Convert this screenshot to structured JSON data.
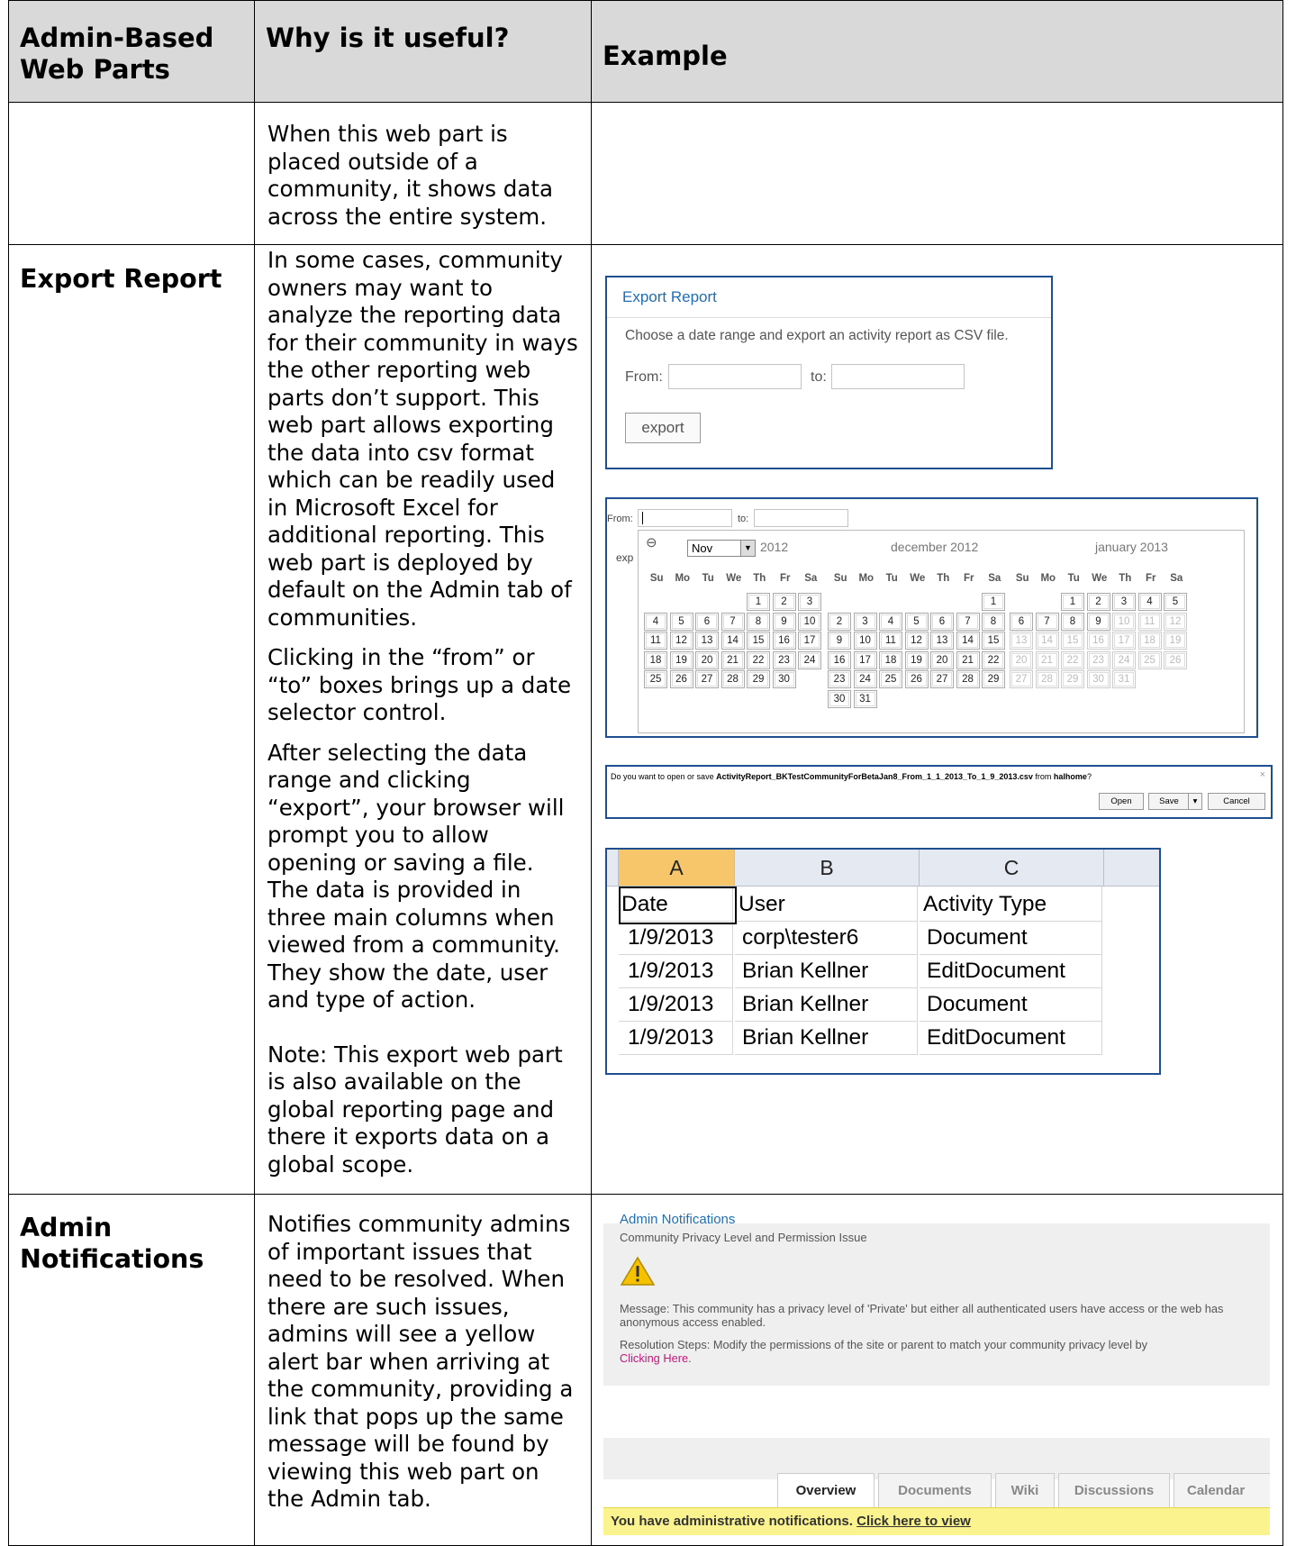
{
  "table": {
    "headers": [
      "Admin-Based Web Parts",
      "Why is it useful?",
      "Example"
    ],
    "row0": {
      "desc": "When this web part is placed outside of a community, it shows data across the entire system."
    },
    "row1": {
      "label": "Export Report",
      "p1": "In some cases, community owners may want to analyze the reporting data for their community in ways the other reporting web parts don’t support.  This web part allows exporting the data into csv format which can be readily used in Microsoft Excel for additional reporting.  This web part is deployed by default on the Admin tab of communities.",
      "p2": "Clicking in the “from” or “to” boxes brings up a date selector control.",
      "p3a": "After selecting the data range and clicking “export”, your browser will prompt you to allow opening or saving a file.",
      "p3b": "The data is provided in three main columns when viewed from a community.  They show the date, user and type of action.",
      "p4": "Note:  This export web part is also available on the global reporting page and there it exports data on a global scope."
    },
    "row2": {
      "label": "Admin Notifications",
      "desc": "Notifies community admins of important issues that need to be resolved.  When there are such issues, admins will see a yellow alert bar when arriving at the community, providing a link that pops up the same message will be found by viewing this web part on the Admin tab."
    }
  },
  "export_panel": {
    "title": "Export Report",
    "desc": "Choose a date range and export an activity report as CSV file.",
    "from_label": "From:",
    "to_label": "to:",
    "button": "export"
  },
  "calendar": {
    "from_label": "From:",
    "to_label": "to:",
    "side_text": "exp",
    "prev_icon": "⊖",
    "month_select": "Nov",
    "year": "2012",
    "month_titles": [
      "december 2012",
      "january 2013"
    ],
    "dow": [
      "Su",
      "Mo",
      "Tu",
      "We",
      "Th",
      "Fr",
      "Sa"
    ]
  },
  "download_prompt": {
    "q1": "Do you want to open or save ",
    "file": "ActivityReport_BKTestCommunityForBetaJan8_From_1_1_2013_To_1_9_2013.csv",
    "q2": " from ",
    "host": "halhome",
    "q3": "?",
    "close": "×",
    "open": "Open",
    "save": "Save",
    "cancel": "Cancel"
  },
  "excel": {
    "columns": [
      "A",
      "B",
      "C"
    ],
    "header": [
      "Date",
      "User",
      "Activity Type"
    ],
    "rows": [
      [
        "1/9/2013",
        "corp\\tester6",
        "Document"
      ],
      [
        "1/9/2013",
        "Brian Kellner",
        "EditDocument"
      ],
      [
        "1/9/2013",
        "Brian Kellner",
        "Document"
      ],
      [
        "1/9/2013",
        "Brian Kellner",
        "EditDocument"
      ]
    ]
  },
  "admin_notifications": {
    "title": "Admin Notifications",
    "issue": "Community Privacy Level and Permission Issue",
    "message": "Message: This community has a privacy level of 'Private' but either all authenticated users have access or the web has anonymous access enabled.",
    "resolution": "Resolution Steps: Modify the permissions of the site or parent to match your community privacy level by",
    "link": "Clicking Here",
    "link_tail": "."
  },
  "tabs": {
    "items": [
      "Overview",
      "Documents",
      "Wiki",
      "Discussions",
      "Calendar"
    ],
    "bar_text": "You have administrative notifications. ",
    "bar_link": "Click here to view"
  }
}
